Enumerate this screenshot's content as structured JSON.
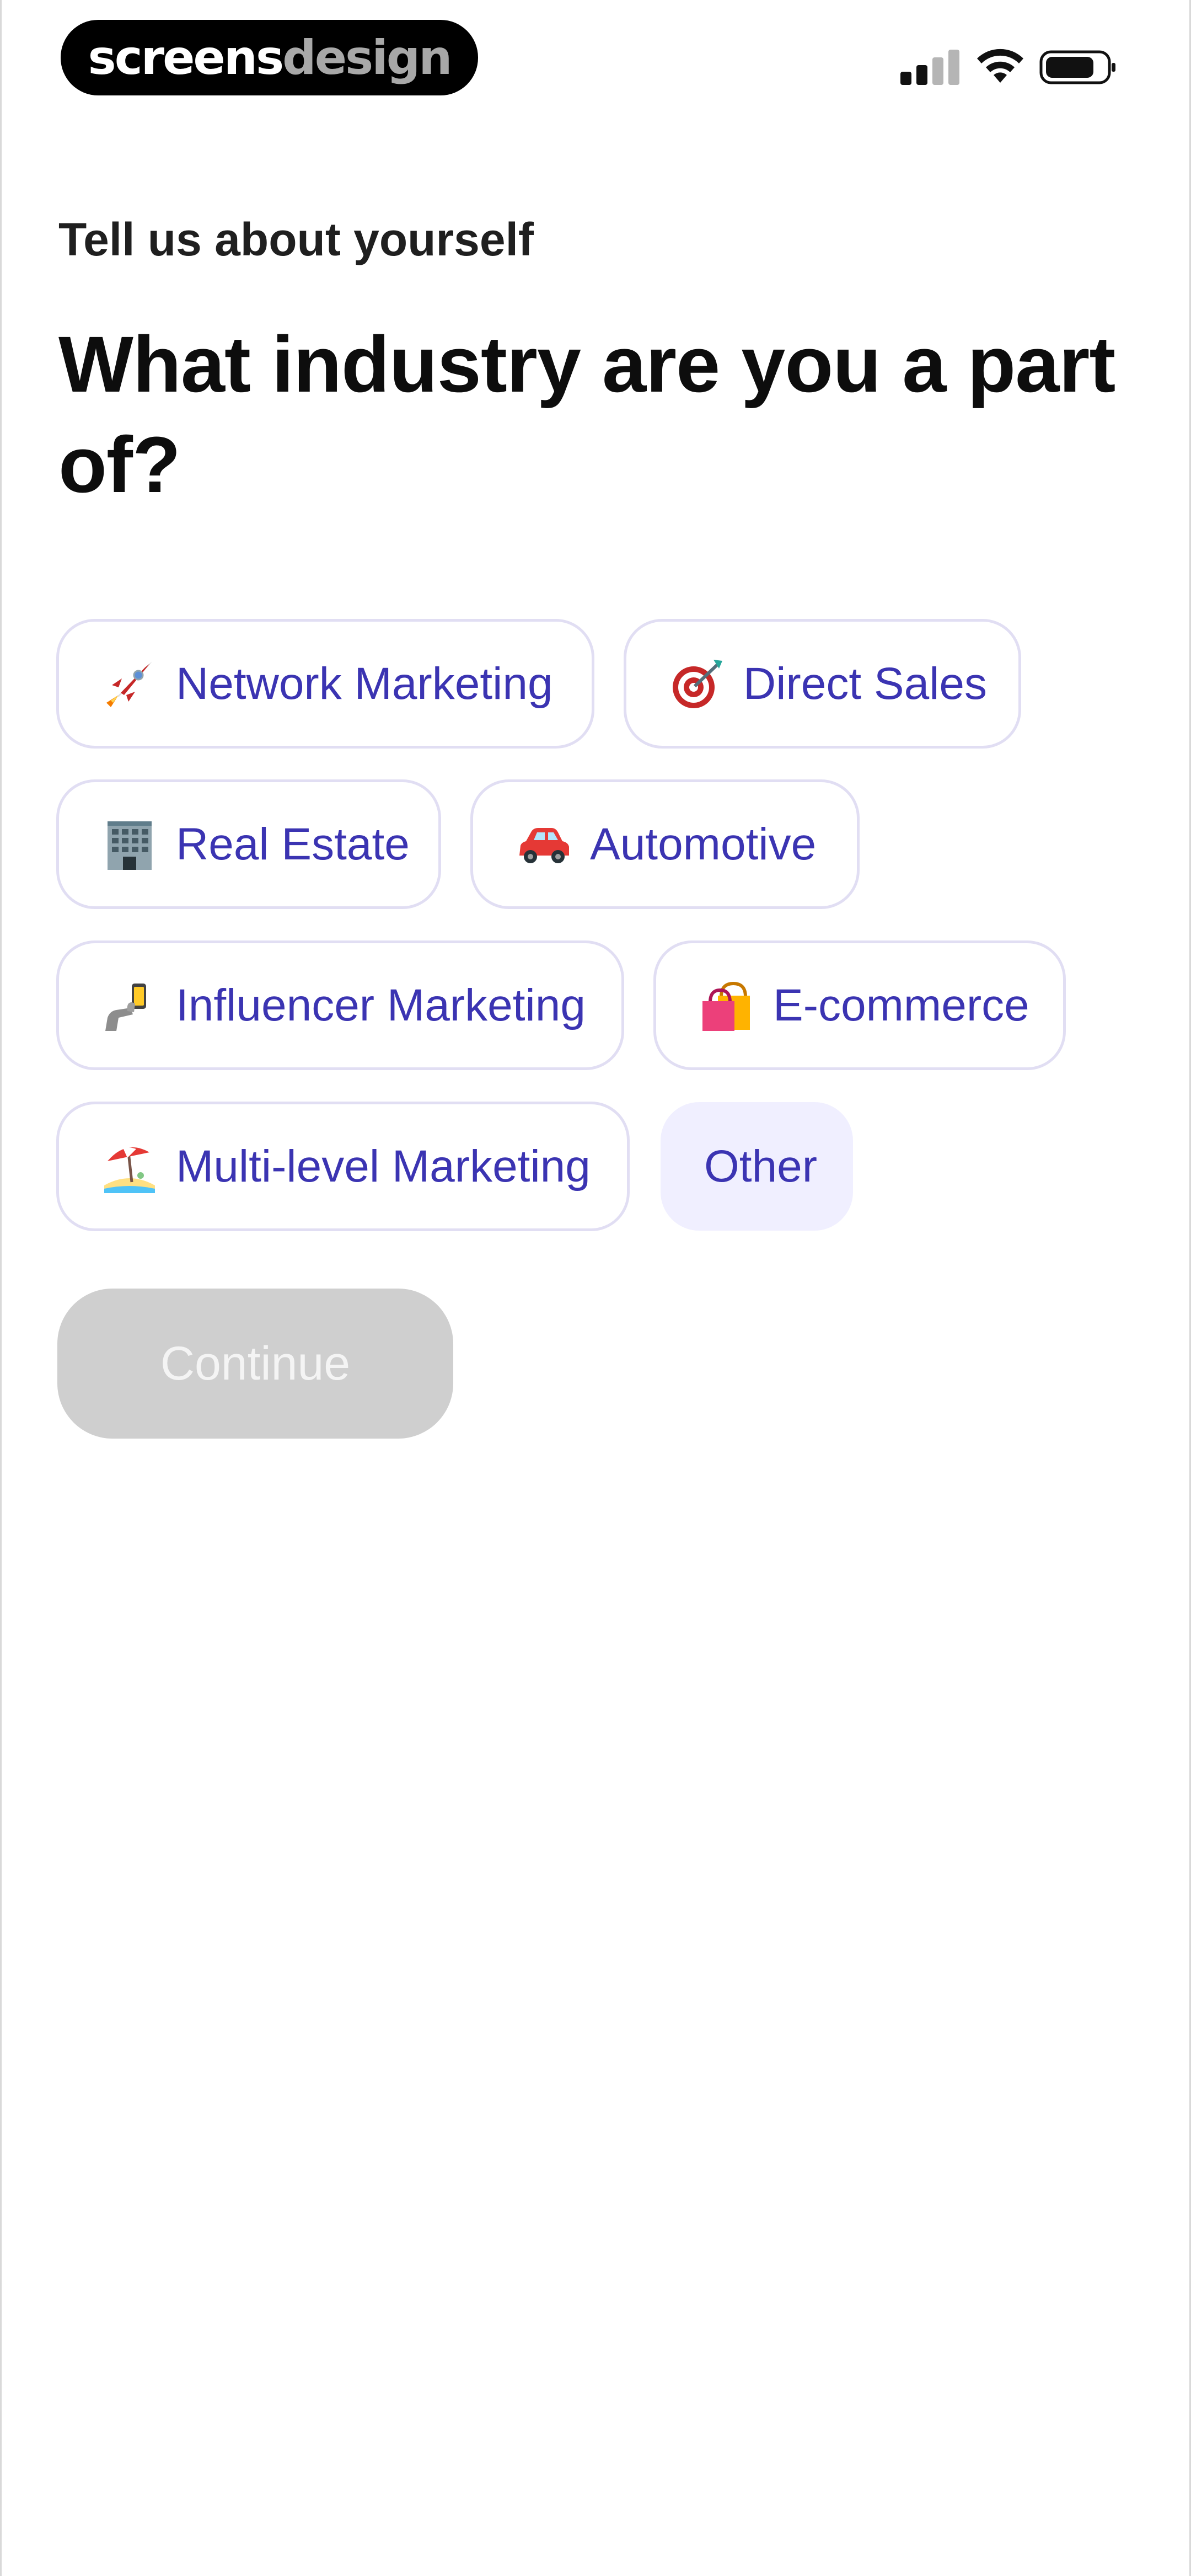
{
  "status_bar": {
    "brand_part1": "screens",
    "brand_part2": "design",
    "icons": [
      "signal-icon",
      "wifi-icon",
      "battery-icon"
    ]
  },
  "header": {
    "eyebrow": "Tell us about yourself",
    "title": "What industry are you a part of?"
  },
  "options": [
    {
      "label": "Network Marketing",
      "icon": "rocket-icon"
    },
    {
      "label": "Direct Sales",
      "icon": "target-icon"
    },
    {
      "label": "Real Estate",
      "icon": "office-building-icon"
    },
    {
      "label": "Automotive",
      "icon": "car-icon"
    },
    {
      "label": "Influencer Marketing",
      "icon": "selfie-icon"
    },
    {
      "label": "E-commerce",
      "icon": "shopping-bags-icon"
    },
    {
      "label": "Multi-level Marketing",
      "icon": "beach-umbrella-icon"
    },
    {
      "label": "Other",
      "icon": ""
    }
  ],
  "continue_button": {
    "label": "Continue",
    "state": "disabled"
  },
  "colors": {
    "accent_text": "#3b34b2",
    "chip_border": "#e1def3",
    "chip_other_bg": "#f0efff",
    "button_disabled_bg": "#cfcfcf"
  }
}
